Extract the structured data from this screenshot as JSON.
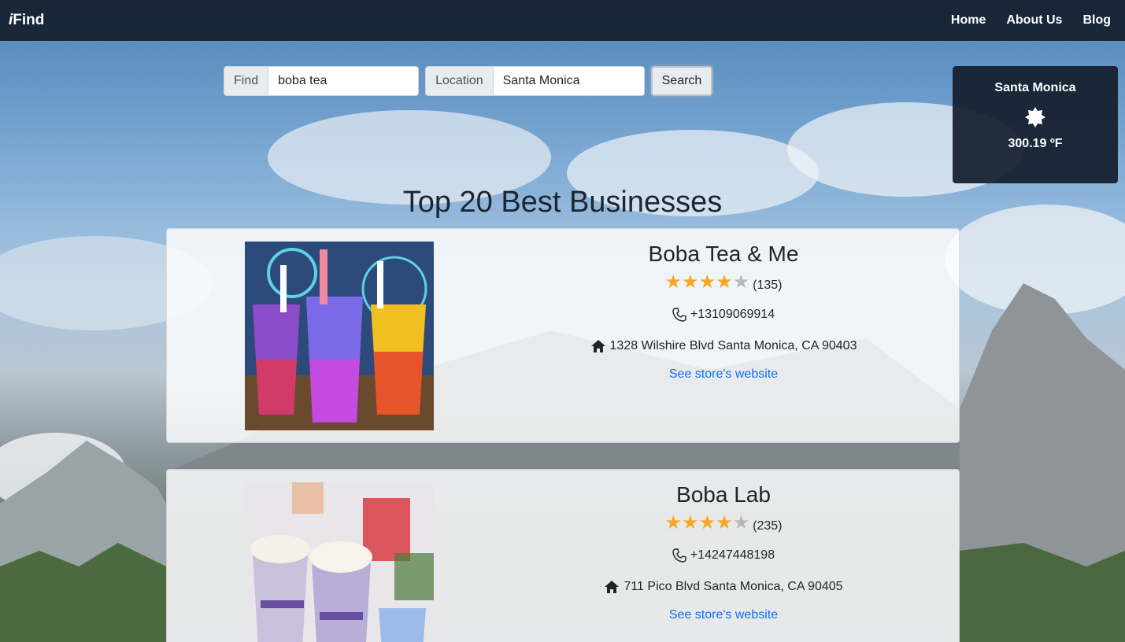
{
  "nav": {
    "brand_prefix": "i",
    "brand_suffix": "Find",
    "links": [
      "Home",
      "About Us",
      "Blog"
    ]
  },
  "search": {
    "find_label": "Find",
    "find_value": "boba tea",
    "location_label": "Location",
    "location_value": "Santa Monica",
    "button_label": "Search"
  },
  "weather": {
    "city": "Santa Monica",
    "icon": "sun-icon",
    "temperature": "300.19 ºF"
  },
  "main": {
    "heading": "Top 20 Best Businesses"
  },
  "businesses": [
    {
      "name": "Boba Tea & Me",
      "rating": 4,
      "max_rating": 5,
      "review_count": "(135)",
      "phone": "+13109069914",
      "address": "1328 Wilshire Blvd Santa Monica, CA 90403",
      "website_label": "See store's website"
    },
    {
      "name": "Boba Lab",
      "rating": 4,
      "max_rating": 5,
      "review_count": "(235)",
      "phone": "+14247448198",
      "address": "711 Pico Blvd Santa Monica, CA 90405",
      "website_label": "See store's website"
    }
  ],
  "colors": {
    "navbar": "#141e2d",
    "star_on": "#f5a623",
    "star_off": "#b8b8b8",
    "link": "#0d6efd"
  }
}
